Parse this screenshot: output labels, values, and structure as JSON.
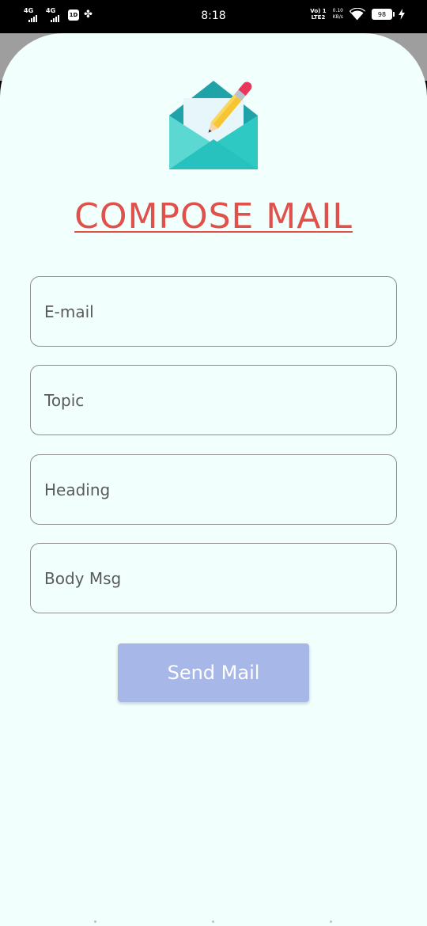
{
  "status_bar": {
    "time": "8:18",
    "network_1": "4G",
    "network_2": "4G",
    "app_icon_text": "1D",
    "volte_top": "Vo) 1",
    "volte_bottom": "LTE2",
    "speed_value": "0.10",
    "speed_unit": "KB/s",
    "battery": "98",
    "icons": [
      "signal-icon",
      "signal-icon",
      "app-notification-icon",
      "pinwheel-icon",
      "wifi-icon",
      "battery-icon",
      "charging-bolt-icon"
    ]
  },
  "compose": {
    "logo_icon": "envelope-pencil-icon",
    "title": "COMPOSE MAIL",
    "email_placeholder": "E-mail",
    "topic_placeholder": "Topic",
    "heading_placeholder": "Heading",
    "body_placeholder": "Body Msg",
    "send_label": "Send Mail"
  },
  "colors": {
    "title": "#e0514b",
    "background": "#f1fffd",
    "button": "#a7b7e8",
    "envelope": "#27c2bd"
  }
}
